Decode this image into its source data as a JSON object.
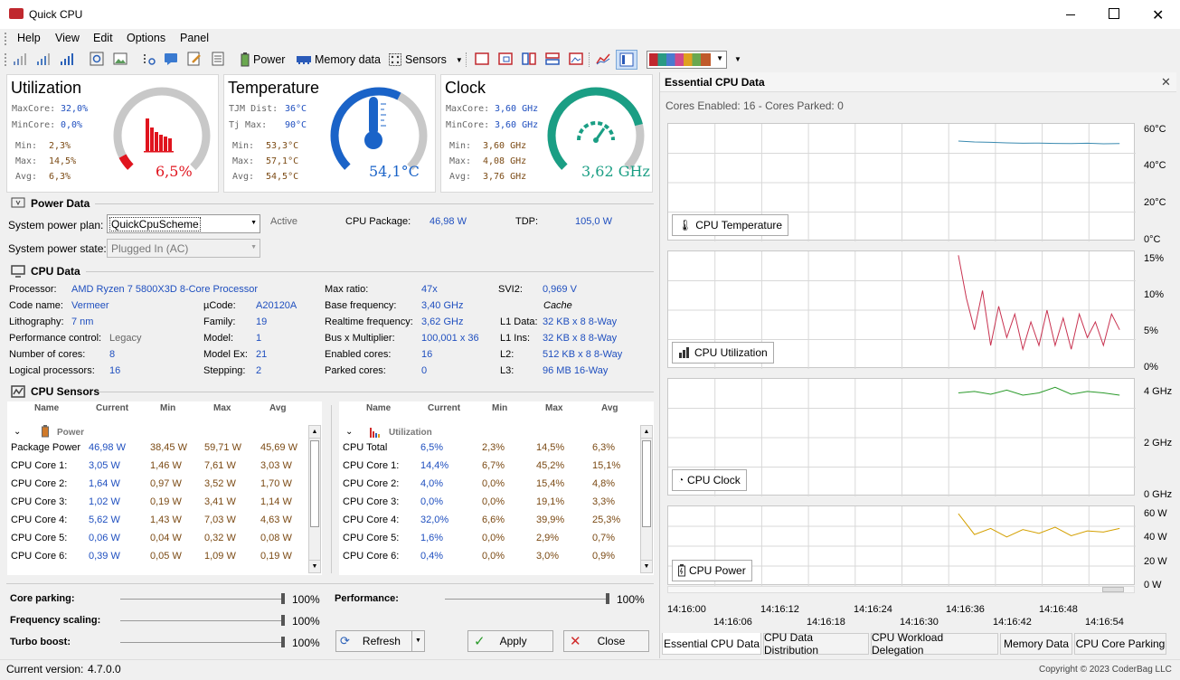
{
  "window": {
    "title": "Quick CPU"
  },
  "menu": {
    "items": [
      "Help",
      "View",
      "Edit",
      "Options",
      "Panel"
    ]
  },
  "toolbar": {
    "power": "Power",
    "memory_data": "Memory data",
    "sensors": "Sensors"
  },
  "utilization": {
    "title": "Utilization",
    "maxcore_lbl": "MaxCore:",
    "maxcore_val": "32,0%",
    "mincore_lbl": "MinCore:",
    "mincore_val": "0,0%",
    "min_lbl": "Min:",
    "min_val": "2,3%",
    "max_lbl": "Max:",
    "max_val": "14,5%",
    "avg_lbl": "Avg:",
    "avg_val": "6,3%",
    "gauge_val": "6,5%",
    "gauge_fraction": 0.065,
    "accent": "#e0141e"
  },
  "temperature": {
    "title": "Temperature",
    "tjm_lbl": "TJM Dist:",
    "tjm_val": "36°C",
    "tj_lbl": "Tj Max:",
    "tj_val": "90°C",
    "min_lbl": "Min:",
    "min_val": "53,3°C",
    "max_lbl": "Max:",
    "max_val": "57,1°C",
    "avg_lbl": "Avg:",
    "avg_val": "54,5°C",
    "gauge_val": "54,1°C",
    "gauge_fraction": 0.6,
    "accent": "#1a63c8"
  },
  "clock": {
    "title": "Clock",
    "maxcore_lbl": "MaxCore:",
    "maxcore_val": "3,60 GHz",
    "mincore_lbl": "MinCore:",
    "mincore_val": "3,60 GHz",
    "min_lbl": "Min:",
    "min_val": "3,60 GHz",
    "max_lbl": "Max:",
    "max_val": "4,08 GHz",
    "avg_lbl": "Avg:",
    "avg_val": "3,76 GHz",
    "gauge_val": "3,62 GHz",
    "gauge_fraction": 0.78,
    "accent": "#1a9e84"
  },
  "power_data": {
    "title": "Power Data",
    "plan_lbl": "System power plan:",
    "plan_val": "QuickCpuScheme",
    "active": "Active",
    "pkg_lbl": "CPU Package:",
    "pkg_val": "46,98 W",
    "tdp_lbl": "TDP:",
    "tdp_val": "105,0 W",
    "state_lbl": "System power state:",
    "state_val": "Plugged In (AC)"
  },
  "cpu_data": {
    "title": "CPU Data",
    "processor_lbl": "Processor:",
    "processor_val": "AMD Ryzen 7 5800X3D 8-Core Processor",
    "codename_lbl": "Code name:",
    "codename_val": "Vermeer",
    "litho_lbl": "Lithography:",
    "litho_val": "7 nm",
    "perf_lbl": "Performance control:",
    "perf_val": "Legacy",
    "cores_lbl": "Number of cores:",
    "cores_val": "8",
    "logical_lbl": "Logical processors:",
    "logical_val": "16",
    "ucode_lbl": "µCode:",
    "ucode_val": "A20120A",
    "family_lbl": "Family:",
    "family_val": "19",
    "model_lbl": "Model:",
    "model_val": "1",
    "modelex_lbl": "Model Ex:",
    "modelex_val": "21",
    "stepping_lbl": "Stepping:",
    "stepping_val": "2",
    "maxratio_lbl": "Max ratio:",
    "maxratio_val": "47x",
    "basefreq_lbl": "Base frequency:",
    "basefreq_val": "3,40 GHz",
    "rtfreq_lbl": "Realtime frequency:",
    "rtfreq_val": "3,62 GHz",
    "bus_lbl": "Bus x Multiplier:",
    "bus_val": "100,001 x 36",
    "enabled_lbl": "Enabled cores:",
    "enabled_val": "16",
    "parked_lbl": "Parked cores:",
    "parked_val": "0",
    "svi2_lbl": "SVI2:",
    "svi2_val": "0,969 V",
    "cache_lbl": "Cache",
    "l1d_lbl": "L1 Data:",
    "l1d_val": "32 KB x 8  8-Way",
    "l1i_lbl": "L1 Ins:",
    "l1i_val": "32 KB x 8  8-Way",
    "l2_lbl": "L2:",
    "l2_val": "512 KB x 8  8-Way",
    "l3_lbl": "L3:",
    "l3_val": "96 MB  16-Way"
  },
  "sensors": {
    "title": "CPU Sensors",
    "headers": [
      "Name",
      "Current",
      "Min",
      "Max",
      "Avg"
    ],
    "power_group": "Power",
    "power_rows": [
      [
        "Package Power",
        "46,98 W",
        "38,45 W",
        "59,71 W",
        "45,69 W"
      ],
      [
        "CPU Core 1:",
        "3,05 W",
        "1,46 W",
        "7,61 W",
        "3,03 W"
      ],
      [
        "CPU Core 2:",
        "1,64 W",
        "0,97 W",
        "3,52 W",
        "1,70 W"
      ],
      [
        "CPU Core 3:",
        "1,02 W",
        "0,19 W",
        "3,41 W",
        "1,14 W"
      ],
      [
        "CPU Core 4:",
        "5,62 W",
        "1,43 W",
        "7,03 W",
        "4,63 W"
      ],
      [
        "CPU Core 5:",
        "0,06 W",
        "0,04 W",
        "0,32 W",
        "0,08 W"
      ],
      [
        "CPU Core 6:",
        "0,39 W",
        "0,05 W",
        "1,09 W",
        "0,19 W"
      ]
    ],
    "util_group": "Utilization",
    "util_rows": [
      [
        "CPU Total",
        "6,5%",
        "2,3%",
        "14,5%",
        "6,3%"
      ],
      [
        "CPU Core 1:",
        "14,4%",
        "6,7%",
        "45,2%",
        "15,1%"
      ],
      [
        "CPU Core 2:",
        "4,0%",
        "0,0%",
        "15,4%",
        "4,8%"
      ],
      [
        "CPU Core 3:",
        "0,0%",
        "0,0%",
        "19,1%",
        "3,3%"
      ],
      [
        "CPU Core 4:",
        "32,0%",
        "6,6%",
        "39,9%",
        "25,3%"
      ],
      [
        "CPU Core 5:",
        "1,6%",
        "0,0%",
        "2,9%",
        "0,7%"
      ],
      [
        "CPU Core 6:",
        "0,4%",
        "0,0%",
        "3,0%",
        "0,9%"
      ]
    ]
  },
  "controls": {
    "core_parking": "Core parking:",
    "core_parking_val": "100%",
    "core_parking_level": 1.0,
    "freq_scaling": "Frequency scaling:",
    "freq_scaling_val": "100%",
    "freq_scaling_level": 1.0,
    "turbo": "Turbo boost:",
    "turbo_val": "100%",
    "turbo_level": 1.0,
    "performance": "Performance:",
    "performance_val": "100%",
    "performance_level": 1.0,
    "refresh": "Refresh",
    "apply": "Apply",
    "close": "Close"
  },
  "essential": {
    "title": "Essential CPU Data",
    "cores_status": "Cores Enabled: 16 - Cores Parked: 0",
    "temp_label": "CPU Temperature",
    "temp_y": [
      "60°C",
      "40°C",
      "20°C",
      "0°C"
    ],
    "util_label": "CPU Utilization",
    "util_y": [
      "15%",
      "10%",
      "5%",
      "0%"
    ],
    "clock_label": "CPU Clock",
    "clock_y": [
      "4 GHz",
      "2 GHz",
      "0 GHz"
    ],
    "power_label": "CPU Power",
    "power_y": [
      "60 W",
      "40 W",
      "20 W",
      "0 W"
    ],
    "x_top": [
      "14:16:00",
      "14:16:12",
      "14:16:24",
      "14:16:36",
      "14:16:48"
    ],
    "x_bottom": [
      "14:16:06",
      "14:16:18",
      "14:16:30",
      "14:16:42",
      "14:16:54"
    ]
  },
  "tabs": [
    "Essential CPU Data",
    "CPU Data Distribution",
    "CPU Workload Delegation",
    "Memory Data",
    "CPU Core Parking"
  ],
  "status": {
    "version_lbl": "Current version:",
    "version_val": "4.7.0.0",
    "copyright": "Copyright © 2023 CoderBag LLC"
  },
  "chart_data": [
    {
      "type": "line",
      "title": "CPU Temperature",
      "x": [
        "14:16:36",
        "14:16:38",
        "14:16:40",
        "14:16:42",
        "14:16:44",
        "14:16:46",
        "14:16:48",
        "14:16:50",
        "14:16:52",
        "14:16:54",
        "14:16:56"
      ],
      "series": [
        {
          "values": [
            55.5,
            55.0,
            54.8,
            54.5,
            54.3,
            54.4,
            54.2,
            54.1,
            54.3,
            54.0,
            54.1
          ]
        }
      ],
      "ylim": [
        0,
        65
      ],
      "color": "#3a8ab0"
    },
    {
      "type": "line",
      "title": "CPU Utilization",
      "x": [
        "14:16:36",
        "14:16:37",
        "14:16:38",
        "14:16:39",
        "14:16:40",
        "14:16:41",
        "14:16:42",
        "14:16:43",
        "14:16:44",
        "14:16:45",
        "14:16:46",
        "14:16:47",
        "14:16:48",
        "14:16:49",
        "14:16:50",
        "14:16:51",
        "14:16:52",
        "14:16:53",
        "14:16:54",
        "14:16:55",
        "14:16:56"
      ],
      "series": [
        {
          "values": [
            14.5,
            9,
            5,
            10,
            3,
            8,
            4,
            7,
            2.5,
            6,
            3,
            7.5,
            3,
            6.5,
            2.5,
            7,
            4,
            6,
            3,
            7,
            5
          ]
        }
      ],
      "ylim": [
        0,
        15
      ],
      "color": "#c83250"
    },
    {
      "type": "line",
      "title": "CPU Clock",
      "x": [
        "14:16:36",
        "14:16:38",
        "14:16:40",
        "14:16:42",
        "14:16:44",
        "14:16:46",
        "14:16:48",
        "14:16:50",
        "14:16:52",
        "14:16:54",
        "14:16:56"
      ],
      "series": [
        {
          "values": [
            3.7,
            3.75,
            3.65,
            3.8,
            3.62,
            3.7,
            3.9,
            3.65,
            3.75,
            3.7,
            3.62
          ]
        }
      ],
      "ylim": [
        0,
        4.2
      ],
      "color": "#2a9a2a"
    },
    {
      "type": "line",
      "title": "CPU Power",
      "x": [
        "14:16:36",
        "14:16:38",
        "14:16:40",
        "14:16:42",
        "14:16:44",
        "14:16:46",
        "14:16:48",
        "14:16:50",
        "14:16:52",
        "14:16:54",
        "14:16:56"
      ],
      "series": [
        {
          "values": [
            59,
            42,
            47,
            40,
            46,
            43,
            48,
            41,
            45,
            44,
            47
          ]
        }
      ],
      "ylim": [
        0,
        65
      ],
      "color": "#d4a000"
    }
  ]
}
